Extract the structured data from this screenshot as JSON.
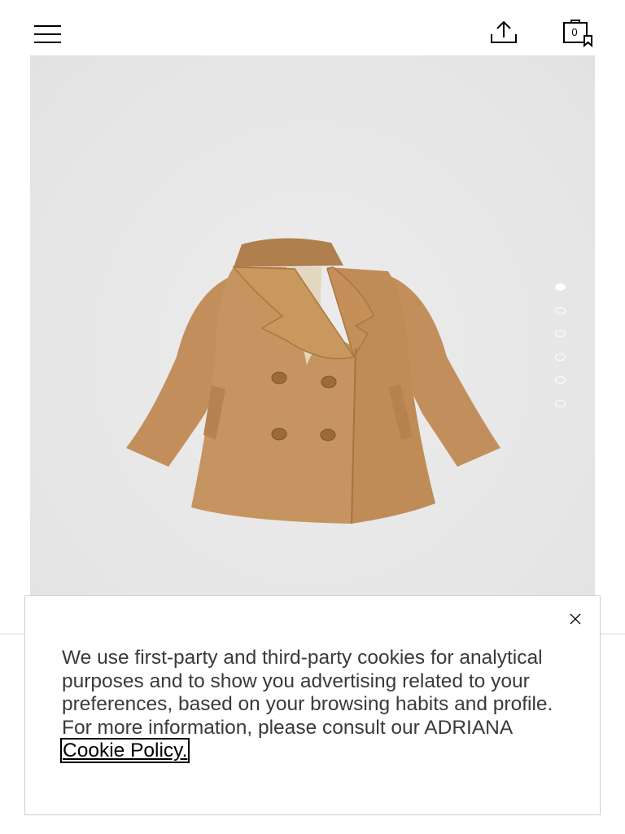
{
  "header": {
    "menu_icon": "hamburger-menu-icon",
    "share_icon": "share-upload-icon",
    "bag_icon": "shopping-bag-icon",
    "bag_count": "0"
  },
  "gallery": {
    "image_alt": "Camel double-breasted baby wool coat",
    "slides": [
      {
        "active": true
      },
      {
        "active": false
      },
      {
        "active": false
      },
      {
        "active": false
      },
      {
        "active": false
      },
      {
        "active": false
      }
    ]
  },
  "cookie_banner": {
    "text": "We use first-party and third-party cookies for analytical purposes and to show you advertising related to your preferences, based on your browsing habits and profile. For more information, please consult our ADRIANA",
    "link_label": "Cookie Policy.",
    "close_icon": "close-icon"
  },
  "colors": {
    "gallery_bg": "#e9e9e9",
    "coat": "#c08e5b",
    "text": "#3a3a3a"
  }
}
